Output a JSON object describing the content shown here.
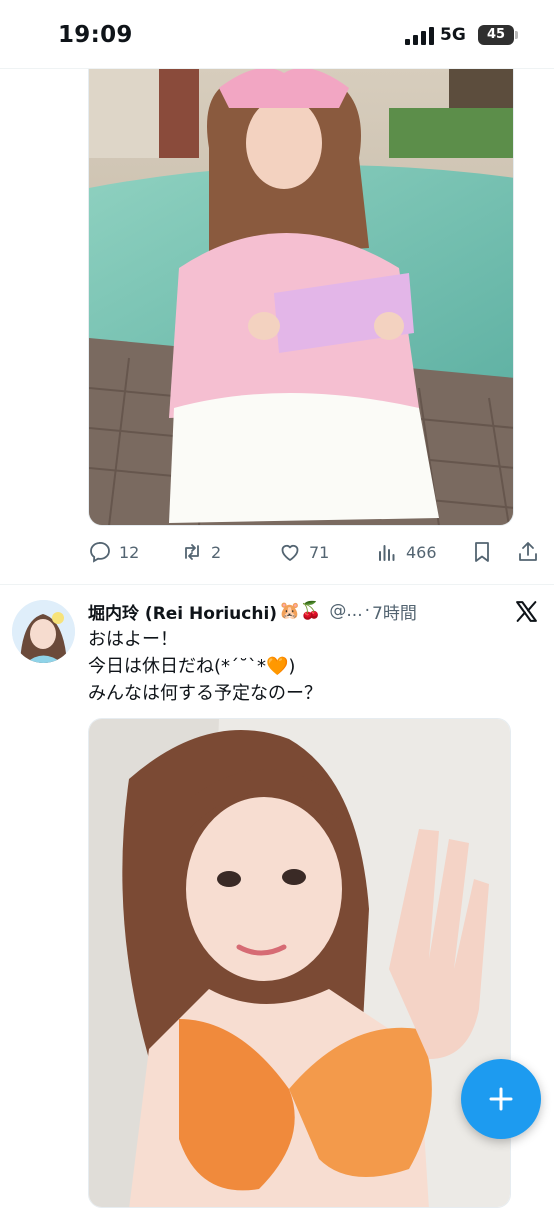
{
  "status_bar": {
    "time": "19:09",
    "network": "5G",
    "battery": "45",
    "signal_icon": "cellular-signal-icon"
  },
  "tweet_1": {
    "photo_icon": "photo-image",
    "actions": {
      "replies": "12",
      "retweets": "2",
      "likes": "71",
      "views": "466"
    },
    "icons": [
      "reply-icon",
      "retweet-icon",
      "like-icon",
      "views-icon",
      "bookmark-icon",
      "share-icon"
    ]
  },
  "tweet_2": {
    "display_name": "堀内玲 (Rei Horiuchi)",
    "emojis": "🐹🍒",
    "handle": "@...",
    "separator": "·",
    "time": "7時間",
    "text_lines": [
      "おはよー！",
      "今日は休日だね(*ˊ˘ˋ*🧡)",
      "みんなは何する予定なのー？"
    ],
    "platform_icon": "x-logo-icon"
  },
  "fab": {
    "icon": "plus-icon"
  },
  "colors": {
    "accent": "#1d9bf0",
    "muted": "#536471",
    "text": "#0f1419"
  }
}
